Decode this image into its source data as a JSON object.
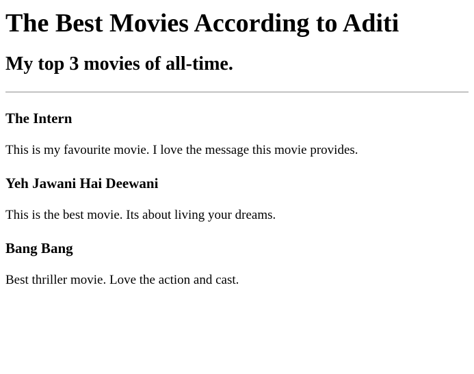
{
  "page": {
    "title": "The Best Movies According to Aditi",
    "subtitle": "My top 3 movies of all-time."
  },
  "movies": [
    {
      "name": "The Intern",
      "description": "This is my favourite movie. I love the message this movie provides."
    },
    {
      "name": "Yeh Jawani Hai Deewani",
      "description": "This is the best movie. Its about living your dreams."
    },
    {
      "name": "Bang Bang",
      "description": "Best thriller movie. Love the action and cast."
    }
  ]
}
